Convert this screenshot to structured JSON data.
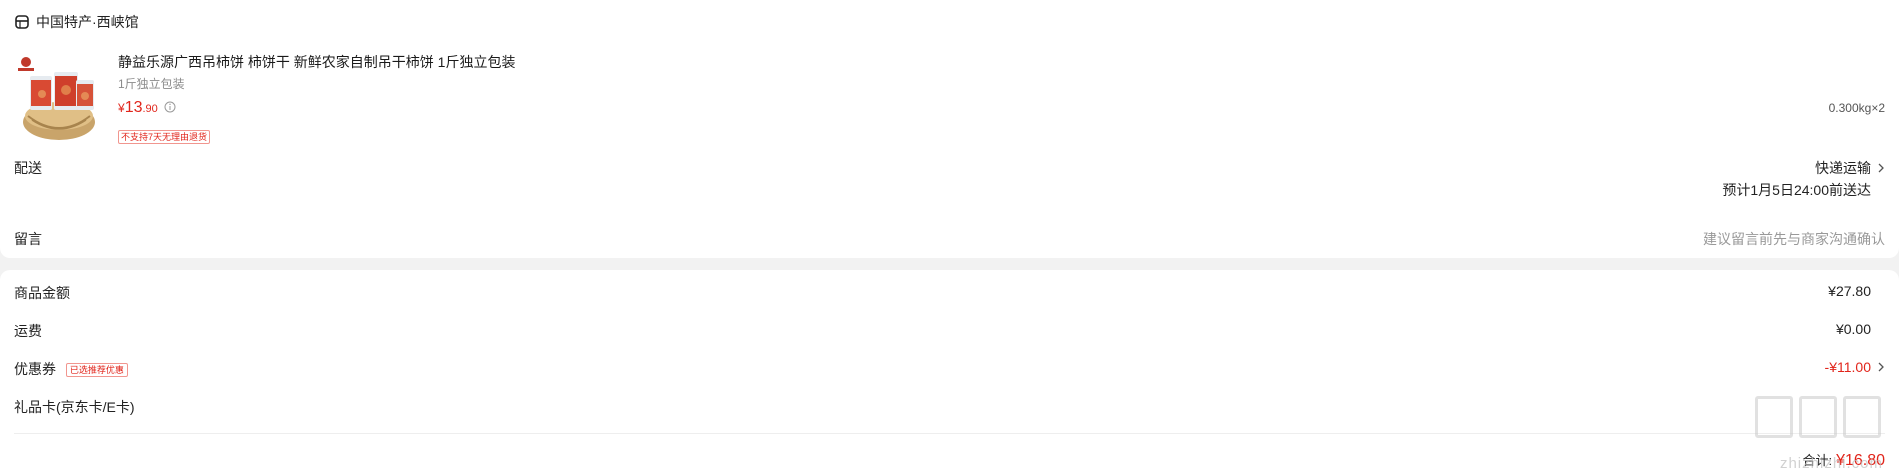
{
  "shop": {
    "name": "中国特产·西峡馆",
    "icon": "store-icon"
  },
  "product": {
    "title": "静益乐源广西吊柿饼 柿饼干 新鲜农家自制吊干柿饼 1斤独立包装",
    "spec": "1斤独立包装",
    "price": {
      "currency": "¥",
      "integer": "13",
      "decimal": ".90"
    },
    "tag": "不支持7天无理由退货",
    "weight": "0.300kg×2"
  },
  "delivery": {
    "label": "配送",
    "method": "快递运输",
    "eta": "预计1月5日24:00前送达"
  },
  "message": {
    "label": "留言",
    "hint": "建议留言前先与商家沟通确认"
  },
  "summary": {
    "goods_amount": {
      "label": "商品金额",
      "value": "¥27.80"
    },
    "shipping": {
      "label": "运费",
      "value": "¥0.00"
    },
    "coupon": {
      "label": "优惠券",
      "tag": "已选推荐优惠",
      "value": "-¥11.00"
    },
    "giftcard": {
      "label": "礼品卡(京东卡/E卡)"
    }
  },
  "total": {
    "label": "合计:",
    "amount": "¥16.80"
  },
  "watermark": {
    "text": "zhizhizhi.com"
  },
  "colors": {
    "accent": "#e1251b",
    "background": "#f2f2f2"
  }
}
